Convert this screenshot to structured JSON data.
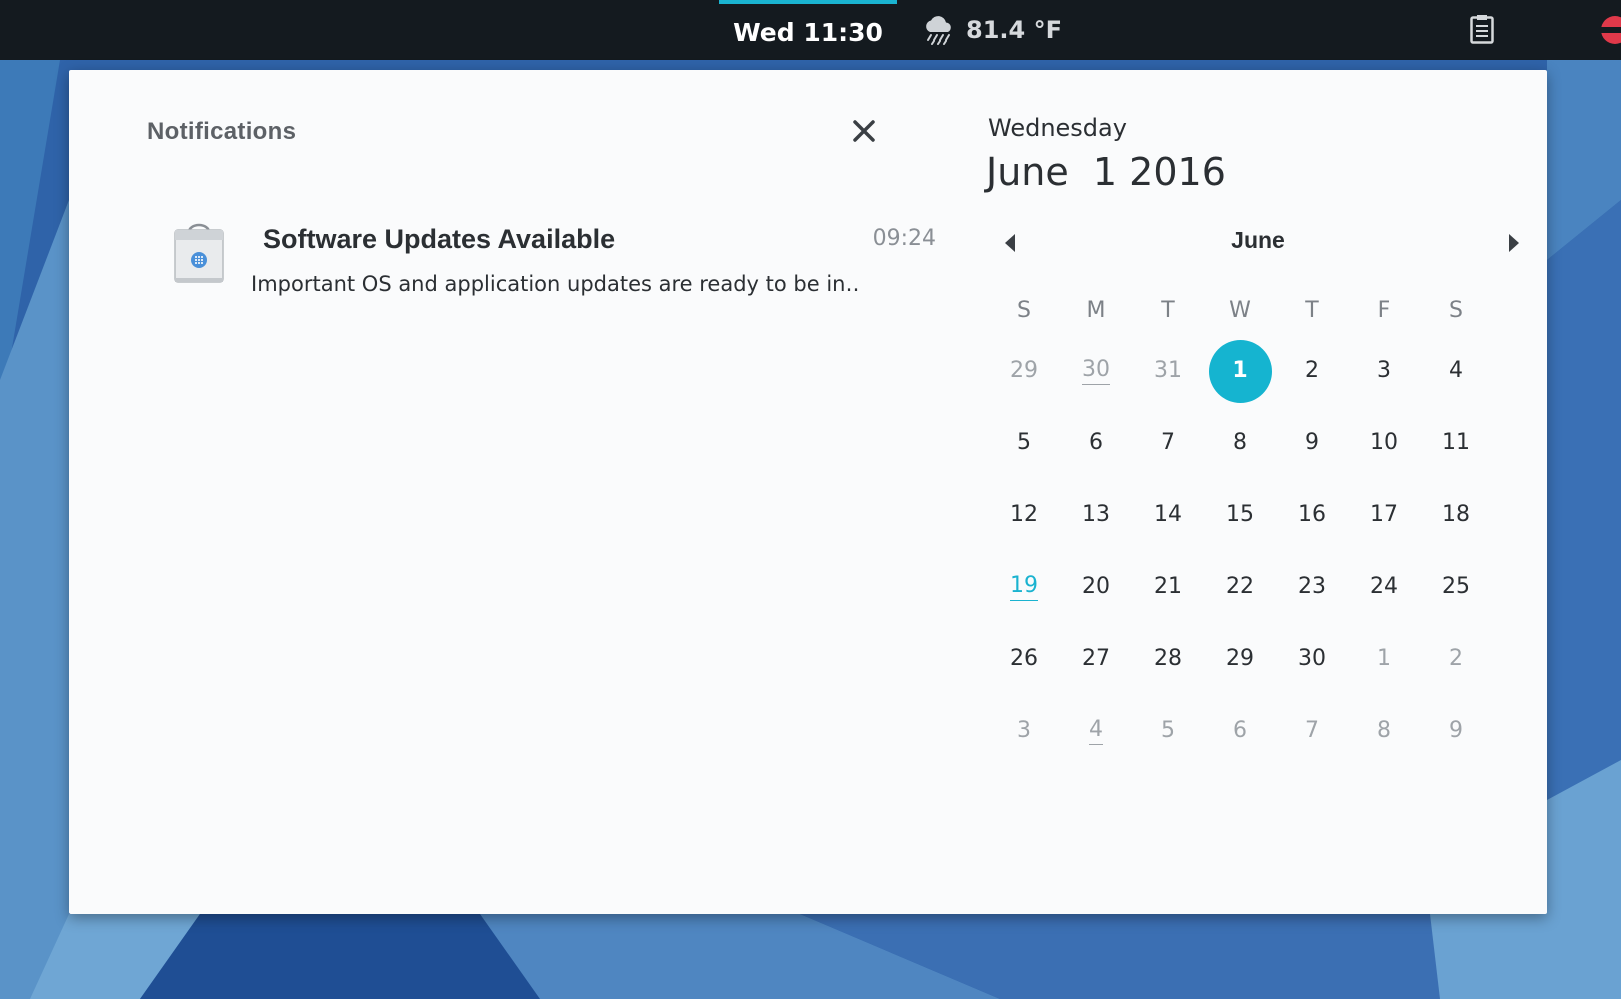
{
  "topbar": {
    "clock": "Wed 11:30",
    "weather": {
      "icon": "rain-cloud-icon",
      "temperature": "81.4 °F"
    },
    "accent_color": "#1ab3d0"
  },
  "notifications": {
    "header": "Notifications",
    "items": [
      {
        "icon": "software-store-bag-icon",
        "title": "Software Updates Available",
        "time": "09:24",
        "body": "Important OS and application updates are ready to be in…"
      }
    ]
  },
  "date": {
    "weekday": "Wednesday",
    "full": "June  1 2016"
  },
  "calendar": {
    "month": "June",
    "weekday_headers": [
      "S",
      "M",
      "T",
      "W",
      "T",
      "F",
      "S"
    ],
    "selected_color": "#15b4d0",
    "weeks": [
      [
        {
          "d": "29",
          "other": true
        },
        {
          "d": "30",
          "other": true,
          "underline": true
        },
        {
          "d": "31",
          "other": true
        },
        {
          "d": "1",
          "selected": true
        },
        {
          "d": "2"
        },
        {
          "d": "3"
        },
        {
          "d": "4"
        }
      ],
      [
        {
          "d": "5"
        },
        {
          "d": "6"
        },
        {
          "d": "7"
        },
        {
          "d": "8"
        },
        {
          "d": "9"
        },
        {
          "d": "10"
        },
        {
          "d": "11"
        }
      ],
      [
        {
          "d": "12"
        },
        {
          "d": "13"
        },
        {
          "d": "14"
        },
        {
          "d": "15"
        },
        {
          "d": "16"
        },
        {
          "d": "17"
        },
        {
          "d": "18"
        }
      ],
      [
        {
          "d": "19",
          "today": true
        },
        {
          "d": "20"
        },
        {
          "d": "21"
        },
        {
          "d": "22"
        },
        {
          "d": "23"
        },
        {
          "d": "24"
        },
        {
          "d": "25"
        }
      ],
      [
        {
          "d": "26"
        },
        {
          "d": "27"
        },
        {
          "d": "28"
        },
        {
          "d": "29"
        },
        {
          "d": "30"
        },
        {
          "d": "1",
          "other": true
        },
        {
          "d": "2",
          "other": true
        }
      ],
      [
        {
          "d": "3",
          "other": true
        },
        {
          "d": "4",
          "other": true,
          "underline": true
        },
        {
          "d": "5",
          "other": true
        },
        {
          "d": "6",
          "other": true
        },
        {
          "d": "7",
          "other": true
        },
        {
          "d": "8",
          "other": true
        },
        {
          "d": "9",
          "other": true
        }
      ]
    ]
  }
}
